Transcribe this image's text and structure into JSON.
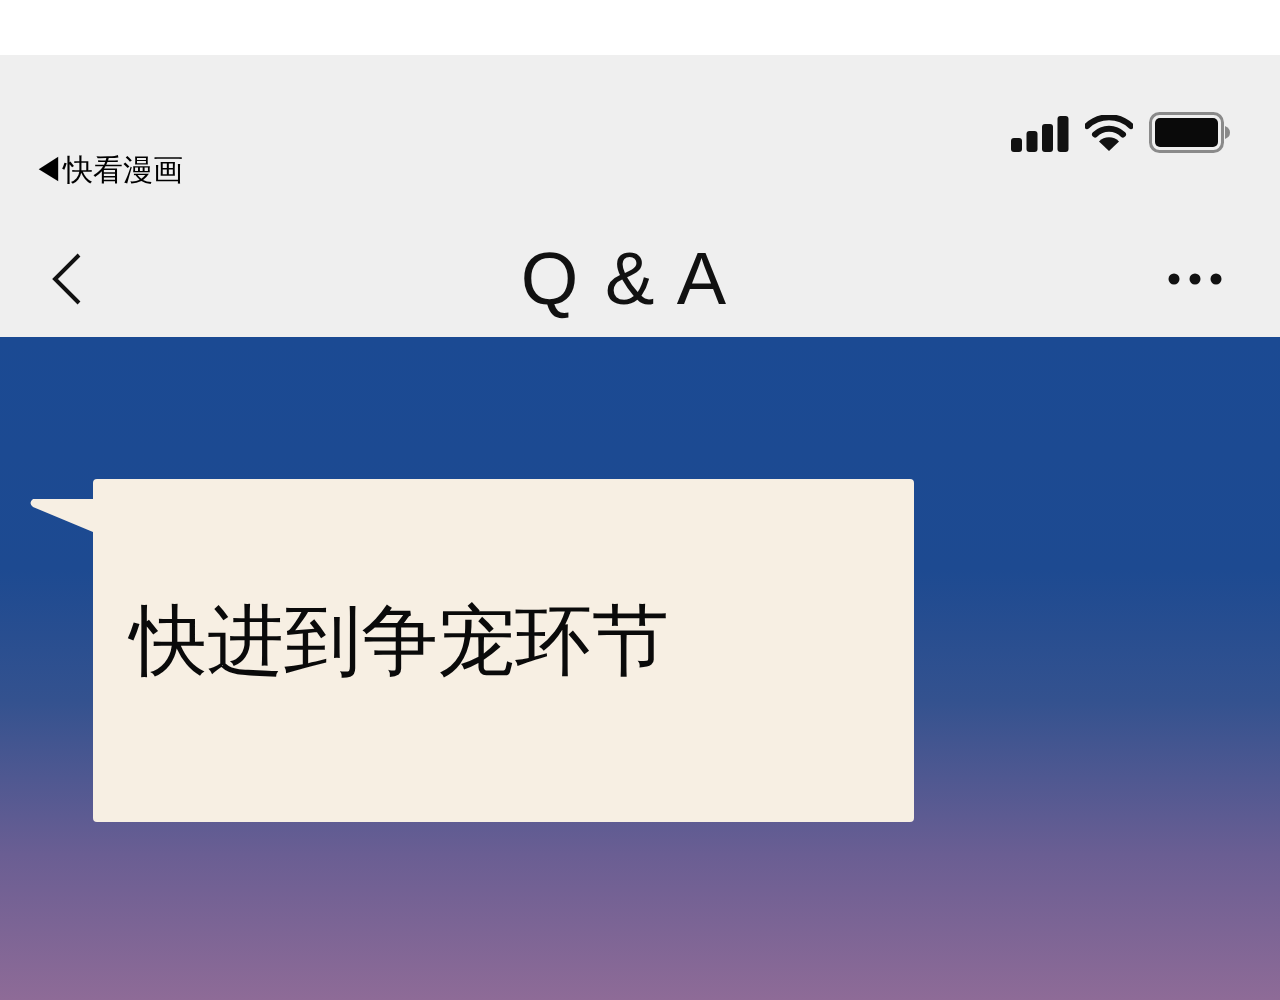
{
  "status_bar": {
    "back_to_app": "◀快看漫画"
  },
  "nav_bar": {
    "title": "Q & A"
  },
  "message": {
    "text": "快进到争宠环节"
  }
}
